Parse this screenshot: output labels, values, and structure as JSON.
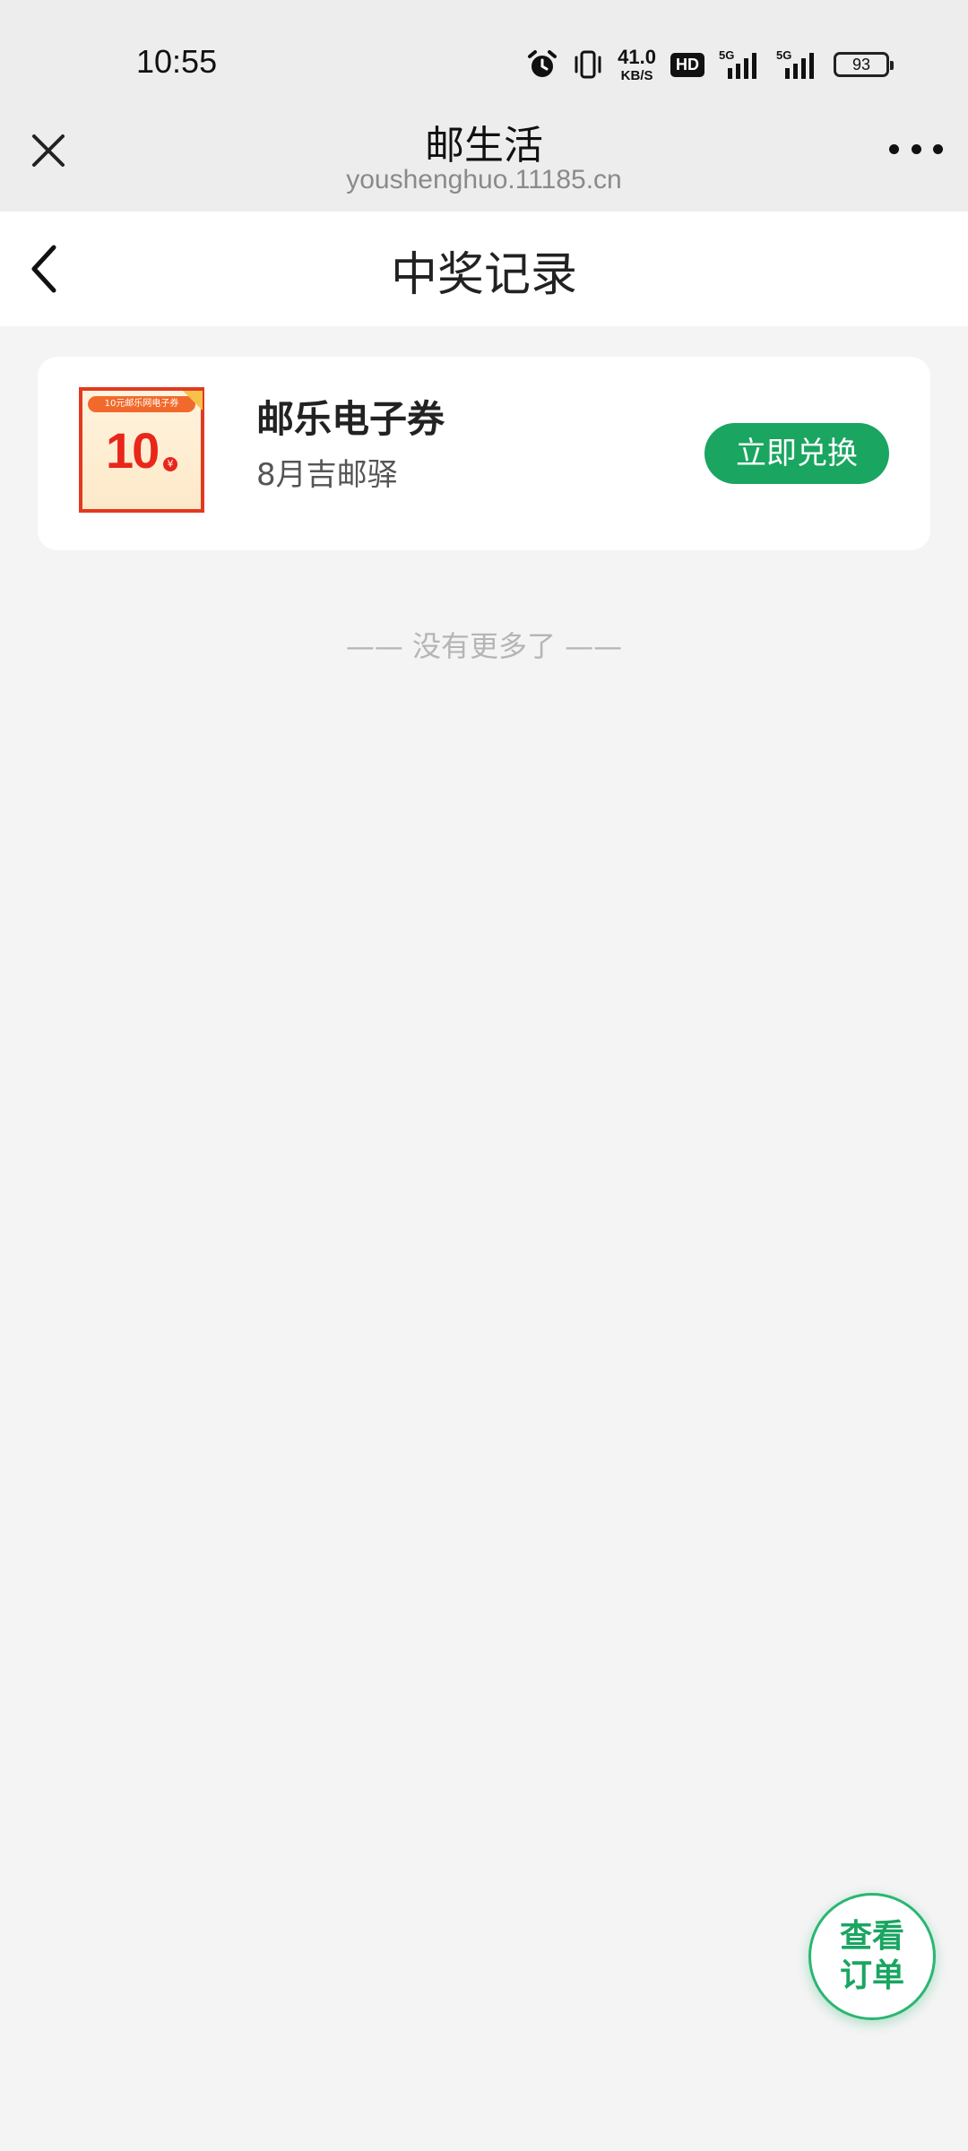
{
  "status_bar": {
    "time": "10:55",
    "net_speed_value": "41.0",
    "net_speed_unit": "KB/S",
    "hd_label": "HD",
    "signal_1_label": "5G",
    "signal_2_label": "5G",
    "battery_level": "93",
    "icons": [
      "alarm-icon",
      "vibrate-icon",
      "hd-icon",
      "signal-icon",
      "signal-icon",
      "battery-icon"
    ]
  },
  "browser": {
    "title": "邮生活",
    "url": "youshenghuo.11185.cn",
    "close_icon": "close-icon",
    "more_icon": "more-icon"
  },
  "page": {
    "back_icon": "back-arrow-icon",
    "title": "中奖记录"
  },
  "prizes": [
    {
      "image": {
        "banner": "10元邮乐网电子券",
        "value": "10",
        "currency": "¥"
      },
      "name": "邮乐电子券",
      "source": "8月吉邮驿",
      "action_label": "立即兑换"
    }
  ],
  "list_end_text": "—— 没有更多了 ——",
  "floating_button": {
    "label": "查看订单"
  },
  "colors": {
    "accent_green": "#1aa561",
    "header_grey": "#ededed",
    "page_bg": "#f4f4f4",
    "coupon_red": "#e23a1f"
  }
}
